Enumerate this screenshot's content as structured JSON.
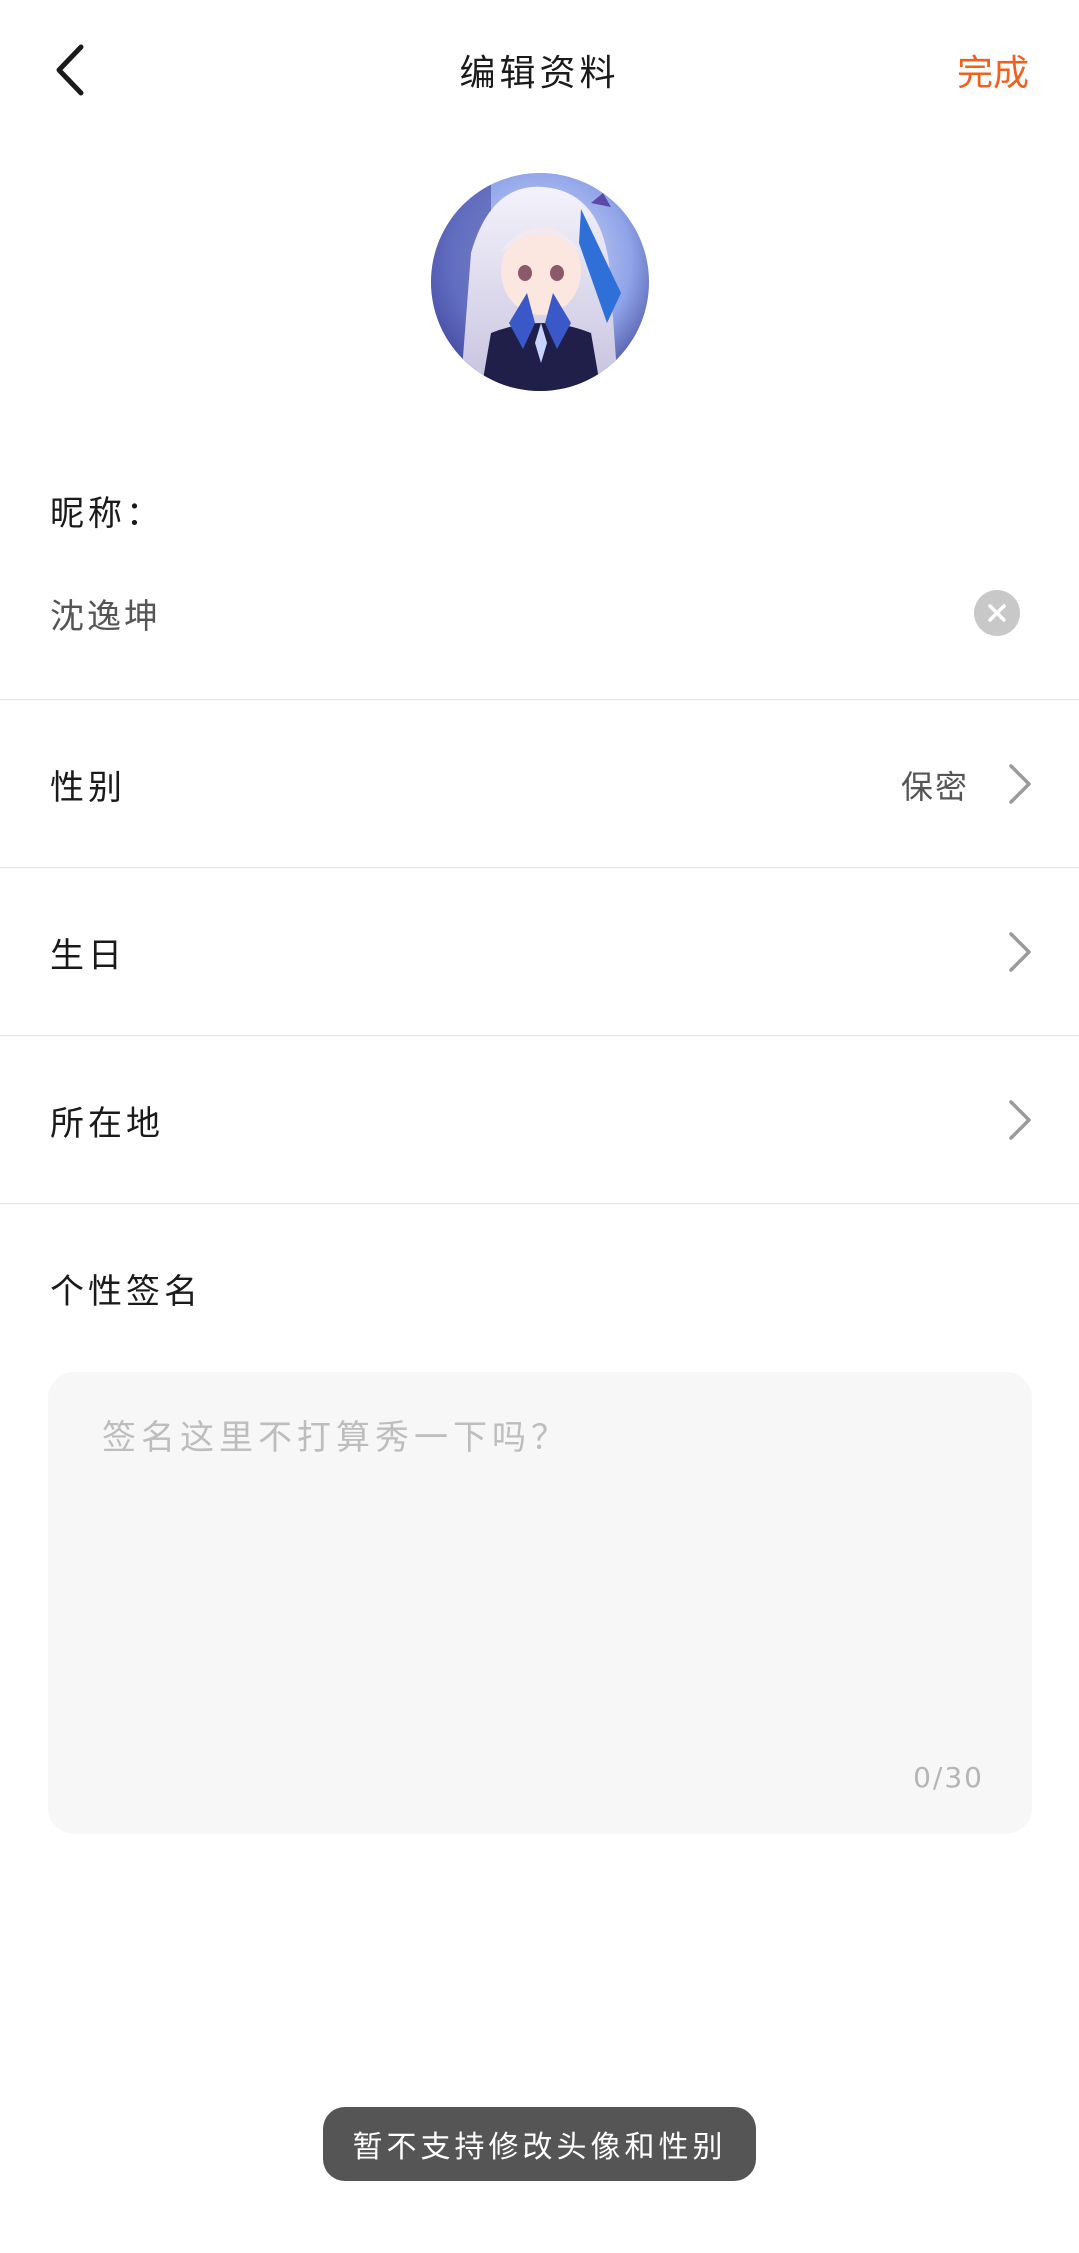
{
  "header": {
    "title": "编辑资料",
    "done_label": "完成",
    "accent_color": "#f0601e"
  },
  "avatar": {
    "icon": "avatar-image"
  },
  "nickname": {
    "label": "昵称：",
    "value": "沈逸坤",
    "clear_icon": "close-icon"
  },
  "rows": [
    {
      "label": "性别",
      "value": "保密",
      "icon": "chevron-right-icon"
    },
    {
      "label": "生日",
      "value": "",
      "icon": "chevron-right-icon"
    },
    {
      "label": "所在地",
      "value": "",
      "icon": "chevron-right-icon"
    }
  ],
  "signature": {
    "label": "个性签名",
    "placeholder": "签名这里不打算秀一下吗？",
    "value": "",
    "counter": "0/30"
  },
  "toast": {
    "message": "暂不支持修改头像和性别"
  }
}
